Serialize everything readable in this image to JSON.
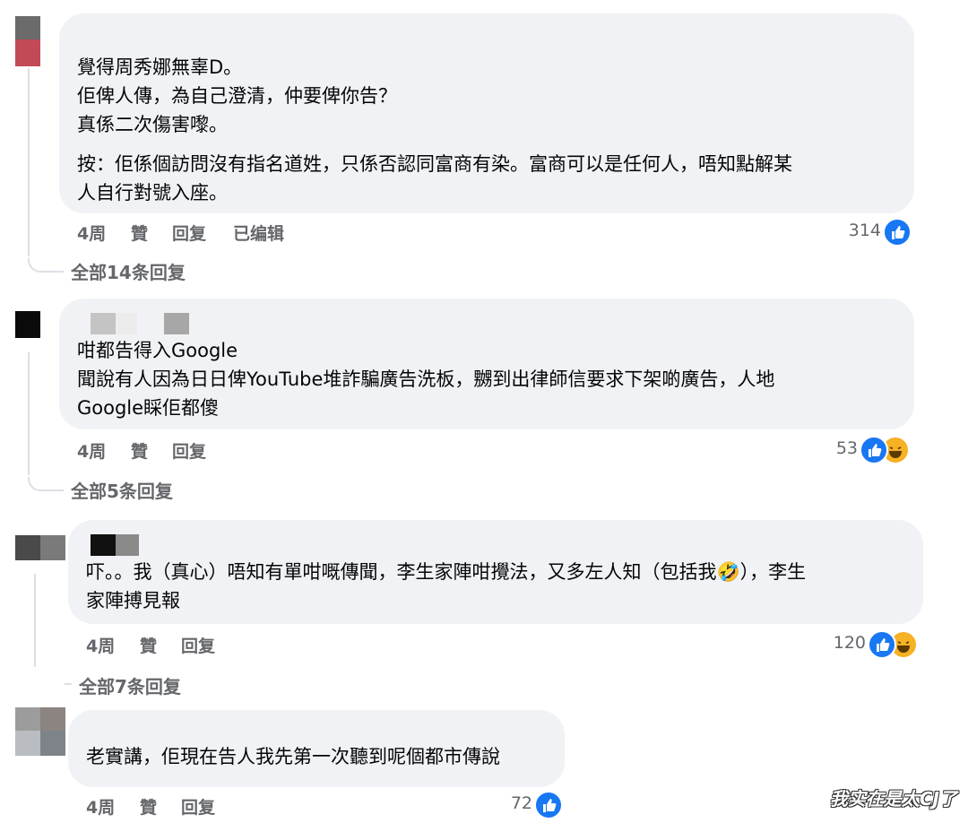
{
  "comments": [
    {
      "lines_a": [
        "覺得周秀娜無辜D。",
        "佢俾人傳，為自己澄清，仲要俾你告？",
        "真係二次傷害嚟。"
      ],
      "lines_b": [
        "按：佢係個訪問沒有指名道姓，只係否認同富商有染。富商可以是任何人，唔知點解某",
        "人自行對號入座。"
      ],
      "time": "4周",
      "like_label": "贊",
      "reply_label": "回复",
      "edited_label": "已编辑",
      "reaction_count": "314",
      "reaction_icons": [
        "like-icon"
      ],
      "replies_link": "全部14条回复"
    },
    {
      "lines": [
        "咁都告得入Google",
        "聞說有人因為日日俾YouTube堆詐騙廣告洗板，嬲到出律師信要求下架啲廣告，人地",
        "Google睬佢都傻"
      ],
      "time": "4周",
      "like_label": "贊",
      "reply_label": "回复",
      "reaction_count": "53",
      "reaction_icons": [
        "like-icon",
        "haha-icon"
      ],
      "replies_link": "全部5条回复"
    },
    {
      "lines": [
        "吓。。我（真心）唔知有單咁嘅傳聞，李生家陣咁攪法，又多左人知（包括我🤣），李生",
        "家陣搏見報"
      ],
      "time": "4周",
      "like_label": "贊",
      "reply_label": "回复",
      "reaction_count": "120",
      "reaction_icons": [
        "like-icon",
        "haha-icon"
      ],
      "replies_link": "全部7条回复"
    },
    {
      "lines": [
        "老實講，佢現在告人我先第一次聽到呢個都市傳說"
      ],
      "time": "4周",
      "like_label": "贊",
      "reply_label": "回复",
      "reaction_count": "72",
      "reaction_icons": [
        "like-icon"
      ]
    }
  ],
  "colors": {
    "bubble": "#f0f2f5",
    "meta_text": "#65676b",
    "like_blue": "#1877f2",
    "haha_yellow": "#f7b125"
  },
  "watermark": "我实在是太CJ了"
}
